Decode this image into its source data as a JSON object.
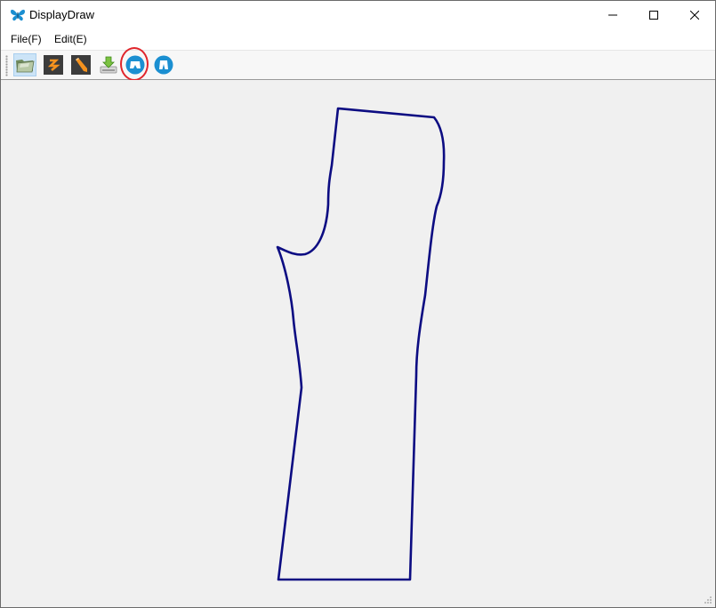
{
  "window": {
    "title": "DisplayDraw",
    "app_icon": "butterfly-icon",
    "controls": [
      "minimize-icon",
      "maximize-icon",
      "close-icon"
    ]
  },
  "menu": {
    "file_label": "File(F)",
    "edit_label": "Edit(E)"
  },
  "toolbar": {
    "buttons": [
      {
        "icon": "open-folder-icon",
        "active": true
      },
      {
        "icon": "zigzag-tool-icon",
        "active": false
      },
      {
        "icon": "pencil-tool-icon",
        "active": false
      },
      {
        "icon": "download-save-icon",
        "active": false
      },
      {
        "icon": "garment-front-icon",
        "active": false,
        "highlighted": true
      },
      {
        "icon": "garment-back-icon",
        "active": false
      }
    ]
  },
  "colors": {
    "outline": "#0c0c82",
    "canvas_background": "#f0f0f0",
    "highlight": "#e0252b",
    "icon_blue": "#1b8fd1",
    "icon_orange": "#f5921e",
    "icon_dark": "#3c3c3c"
  },
  "canvas": {
    "content": "pattern-piece-outline"
  }
}
